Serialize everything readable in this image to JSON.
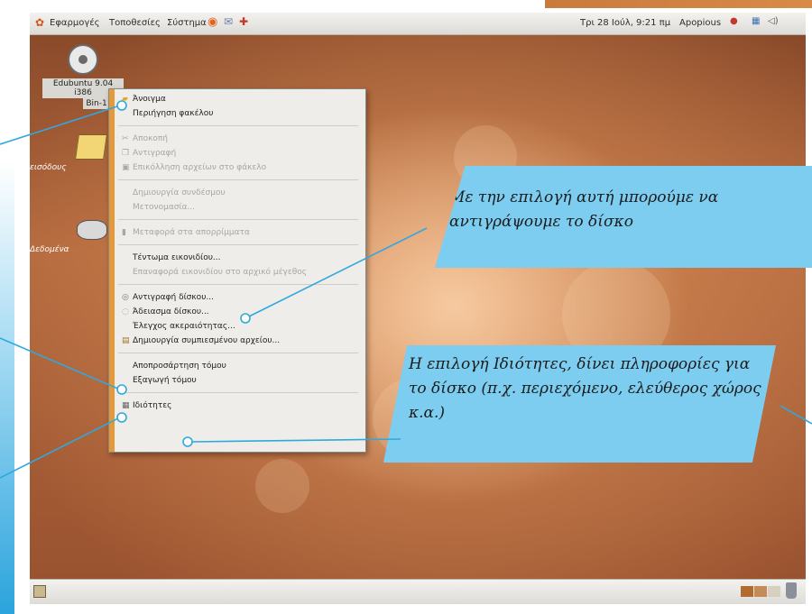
{
  "topbar": {
    "menus": [
      "Εφαρμογές",
      "Τοποθεσίες",
      "Σύστημα"
    ],
    "clock": "Τρι 28 Ιούλ, 9:21 πμ",
    "user": "Apopious"
  },
  "desktop_icons": [
    {
      "label": "Edubuntu 9.04 i386",
      "sublabel": "Bin-1",
      "icon": "cd-icon"
    },
    {
      "label": "εισόδους",
      "icon": "folder-icon"
    },
    {
      "label": "Δεδομένα",
      "icon": "drive-icon"
    }
  ],
  "context_menu": {
    "items": [
      {
        "label": "Άνοιγμα",
        "icon": "folder-open-icon",
        "enabled": true
      },
      {
        "label": "Περιήγηση φακέλου",
        "enabled": true
      },
      {
        "label": "Αποκοπή",
        "icon": "cut-icon",
        "enabled": false
      },
      {
        "label": "Αντιγραφή",
        "icon": "copy-icon",
        "enabled": false
      },
      {
        "label": "Επικόλληση αρχείων στο φάκελο",
        "icon": "paste-icon",
        "enabled": false
      },
      {
        "label": "Δημιουργία συνδέσμου",
        "enabled": false
      },
      {
        "label": "Μετονομασία...",
        "enabled": false
      },
      {
        "label": "Μεταφορά στα απορρίμματα",
        "icon": "trash-icon",
        "enabled": false
      },
      {
        "label": "Τέντωμα εικονιδίου...",
        "enabled": true
      },
      {
        "label": "Επαναφορά εικονιδίου στο αρχικό μέγεθος",
        "enabled": false
      },
      {
        "label": "Αντιγραφή δίσκου...",
        "icon": "disc-icon",
        "enabled": true
      },
      {
        "label": "Άδειασμα δίσκου...",
        "icon": "erase-icon",
        "enabled": true
      },
      {
        "label": "Έλεγχος ακεραιότητας...",
        "enabled": true
      },
      {
        "label": "Δημιουργία συμπιεσμένου αρχείου...",
        "icon": "archive-icon",
        "enabled": true
      },
      {
        "label": "Αποπροσάρτηση τόμου",
        "enabled": true
      },
      {
        "label": "Εξαγωγή τόμου",
        "enabled": true
      },
      {
        "label": "Ιδιότητες",
        "icon": "properties-icon",
        "enabled": true
      }
    ]
  },
  "callouts": {
    "copy_disc": "Με την επιλογή αυτή μπορούμε να αντιγράψουμε το δίσκο",
    "properties": "Η επιλογή Ιδιότητες, δίνει πληροφορίες για το δίσκο (π.χ. περιεχόμενο, ελεύθερος χώρος κ.α.)"
  },
  "colors": {
    "callout_bg": "#7dcdf0",
    "menu_stripe": "#e49a3a",
    "leader_line": "#2fa8e0"
  }
}
